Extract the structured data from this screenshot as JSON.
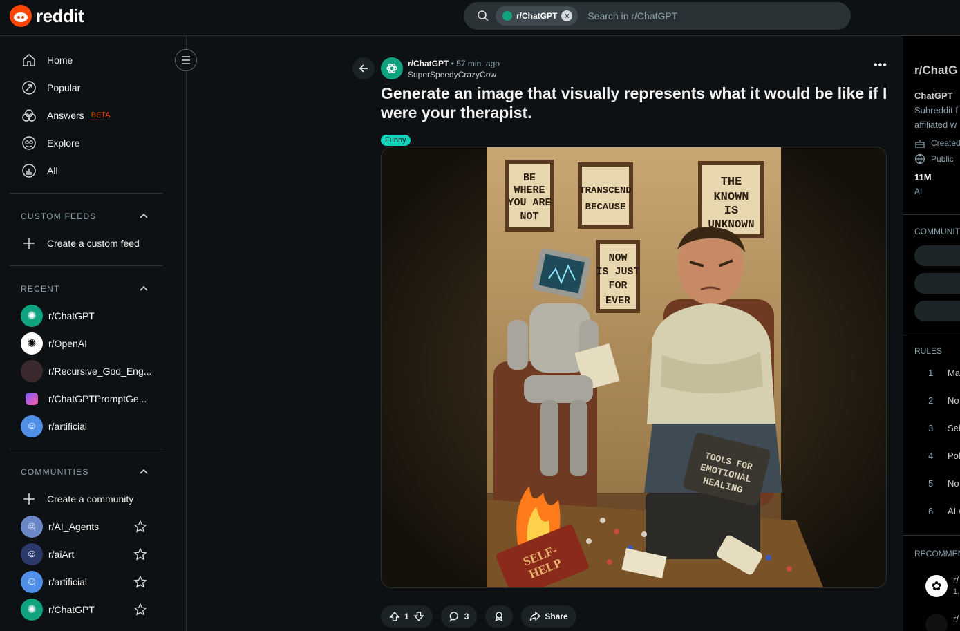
{
  "header": {
    "logo_text": "reddit",
    "search_chip": "r/ChatGPT",
    "search_placeholder": "Search in r/ChatGPT"
  },
  "nav": [
    {
      "label": "Home",
      "icon": "home-icon"
    },
    {
      "label": "Popular",
      "icon": "popular-icon"
    },
    {
      "label": "Answers",
      "icon": "answers-icon",
      "badge": "BETA"
    },
    {
      "label": "Explore",
      "icon": "explore-icon"
    },
    {
      "label": "All",
      "icon": "all-icon"
    }
  ],
  "custom_feeds": {
    "title": "CUSTOM FEEDS",
    "create": "Create a custom feed"
  },
  "recent": {
    "title": "RECENT",
    "items": [
      "r/ChatGPT",
      "r/OpenAI",
      "r/Recursive_God_Eng...",
      "r/ChatGPTPromptGe...",
      "r/artificial"
    ]
  },
  "communities": {
    "title": "COMMUNITIES",
    "create": "Create a community",
    "items": [
      "r/AI_Agents",
      "r/aiArt",
      "r/artificial",
      "r/ChatGPT"
    ]
  },
  "post": {
    "subreddit": "r/ChatGPT",
    "time": "57 min. ago",
    "author": "SuperSpeedyCrazyCow",
    "title": "Generate an image that visually represents what it would be like if I were your therapist.",
    "flair": "Funny",
    "votes": "1",
    "comments": "3",
    "share": "Share",
    "signs": [
      "BE WHERE YOU ARE NOT",
      "TRANSCEND BECAUSE",
      "THE KNOWN IS UNKNOWN",
      "NOW IS JUST FOR EVER",
      "TOOLS FOR EMOTIONAL HEALING",
      "SELF-HELP"
    ]
  },
  "right": {
    "title": "r/ChatG",
    "name": "ChatGPT",
    "desc1": "Subreddit f",
    "desc2": "affiliated w",
    "created": "Created",
    "public": "Public",
    "members": "11M",
    "members_label": "AI",
    "communities_head": "COMMUNIT",
    "rules_head": "RULES",
    "rules": [
      {
        "n": "1",
        "t": "Ma"
      },
      {
        "n": "2",
        "t": "No"
      },
      {
        "n": "3",
        "t": "Sel"
      },
      {
        "n": "4",
        "t": "Pol"
      },
      {
        "n": "5",
        "t": "No"
      },
      {
        "n": "6",
        "t": "AI /"
      }
    ],
    "recommended_head": "RECOMMEN",
    "rec1": "r/",
    "rec1_sub": "1,",
    "rec2": "r/"
  },
  "colors": {
    "accent": "#ff4500",
    "chatgpt": "#10a37f",
    "flair": "#0dd3bb"
  }
}
